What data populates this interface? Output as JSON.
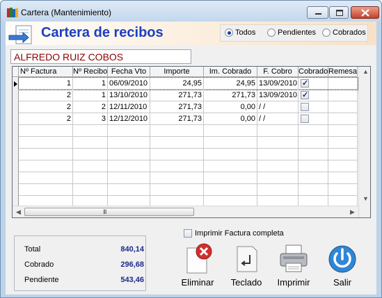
{
  "window": {
    "title": "Cartera (Mantenimiento)"
  },
  "header": {
    "title": "Cartera de recibos",
    "filter": {
      "options": [
        {
          "label": "Todos",
          "selected": true
        },
        {
          "label": "Pendientes",
          "selected": false
        },
        {
          "label": "Cobrados",
          "selected": false
        }
      ]
    }
  },
  "client_name": "ALFREDO RUIZ COBOS",
  "grid": {
    "columns": [
      "Nº Factura",
      "Nº Recibo",
      "Fecha Vto",
      "Importe",
      "Im. Cobrado",
      "F. Cobro",
      "Cobrado",
      "Remesa"
    ],
    "rows": [
      {
        "factura": "1",
        "recibo": "1",
        "fecha_vto": "06/09/2010",
        "importe": "24,95",
        "im_cobrado": "24,95",
        "f_cobro": "13/09/2010",
        "cobrado": true,
        "remesa": ""
      },
      {
        "factura": "2",
        "recibo": "1",
        "fecha_vto": "13/10/2010",
        "importe": "271,73",
        "im_cobrado": "271,73",
        "f_cobro": "13/09/2010",
        "cobrado": true,
        "remesa": ""
      },
      {
        "factura": "2",
        "recibo": "2",
        "fecha_vto": "12/11/2010",
        "importe": "271,73",
        "im_cobrado": "0,00",
        "f_cobro": "/  /",
        "cobrado": false,
        "remesa": ""
      },
      {
        "factura": "2",
        "recibo": "3",
        "fecha_vto": "12/12/2010",
        "importe": "271,73",
        "im_cobrado": "0,00",
        "f_cobro": "/  /",
        "cobrado": false,
        "remesa": ""
      }
    ],
    "scroll_grip": "III"
  },
  "print_check": {
    "label": "Imprimir Factura completa",
    "checked": false
  },
  "totals": {
    "total_label": "Total",
    "total_value": "840,14",
    "cobrado_label": "Cobrado",
    "cobrado_value": "296,68",
    "pendiente_label": "Pendiente",
    "pendiente_value": "543,46"
  },
  "toolbar": {
    "eliminar": "Eliminar",
    "teclado": "Teclado",
    "imprimir": "Imprimir",
    "salir": "Salir"
  },
  "icons": {
    "title_icon": "books-icon",
    "header_icon": "document-arrow-icon",
    "eliminar_icon": "delete-document-icon",
    "teclado_icon": "enter-key-icon",
    "imprimir_icon": "printer-icon",
    "salir_icon": "power-icon"
  },
  "colors": {
    "header_title": "#1c3ec4",
    "client_name": "#8b0000",
    "totals_value": "#1c2a8c"
  }
}
